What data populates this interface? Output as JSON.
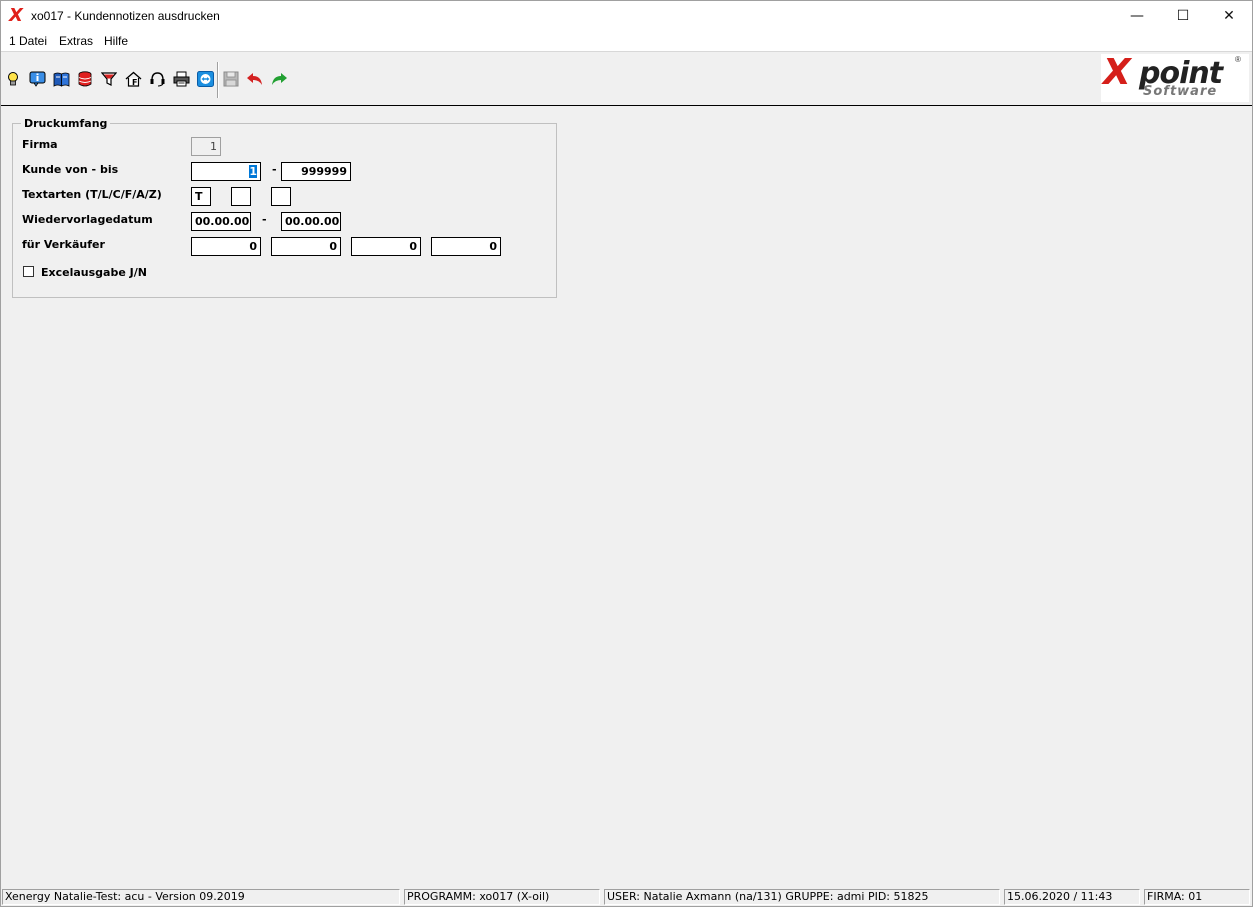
{
  "window": {
    "title": "xo017 - Kundennotizen ausdrucken",
    "minimize_glyph": "—",
    "maximize_glyph": "☐",
    "close_glyph": "✕"
  },
  "menu": {
    "items": [
      "1 Datei",
      "Extras",
      "Hilfe"
    ]
  },
  "toolbar": {
    "icons": [
      "lightbulb-icon",
      "info-icon",
      "book-icon",
      "database-icon",
      "filter-icon",
      "home-icon",
      "headset-icon",
      "printer-icon",
      "teamviewer-icon",
      "save-icon",
      "undo-icon",
      "redo-icon"
    ]
  },
  "logo": {
    "mark": "X",
    "word": "point",
    "sub": "Software",
    "reg": "®"
  },
  "form": {
    "group_title": "Druckumfang",
    "firma": {
      "label": "Firma",
      "value": "1"
    },
    "kunde": {
      "label": "Kunde von - bis",
      "from": "1",
      "sep": "-",
      "to": "999999"
    },
    "textarten": {
      "label": "Textarten (T/L/C/F/A/Z)",
      "v1": "T",
      "v2": "",
      "v3": ""
    },
    "wiedervorlage": {
      "label": "Wiedervorlagedatum",
      "from": "00.00.00",
      "sep": "-",
      "to": "00.00.00"
    },
    "verkaeufer": {
      "label": "für Verkäufer",
      "v1": "0",
      "v2": "0",
      "v3": "0",
      "v4": "0"
    },
    "excel": {
      "label": "Excelausgabe J/N",
      "checked": false
    }
  },
  "status": {
    "version": "Xenergy Natalie-Test: acu - Version 09.2019",
    "programm": "PROGRAMM: xo017 (X-oil)",
    "user": "USER: Natalie Axmann (na/131)  GRUPPE: admi  PID: 51825",
    "datetime": "15.06.2020 / 11:43",
    "firma": "FIRMA: 01"
  }
}
